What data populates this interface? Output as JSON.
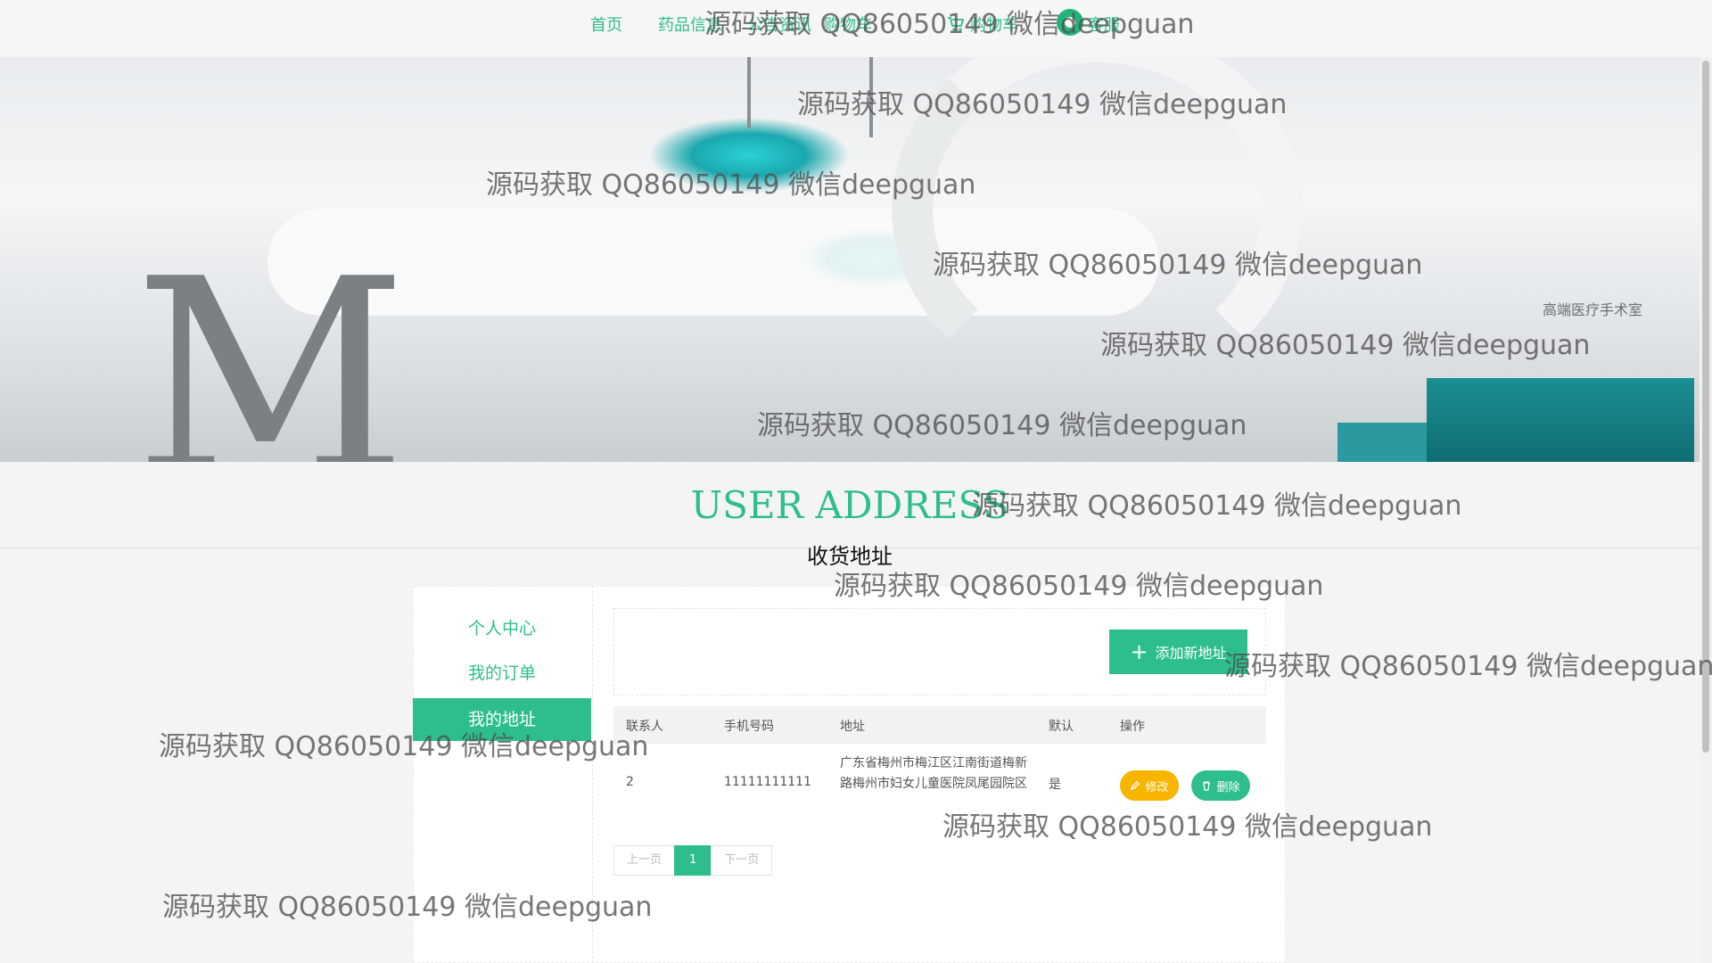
{
  "nav": {
    "items": [
      "首页",
      "药品信息",
      "公告资讯",
      "购物车",
      "客服"
    ],
    "cart_label": "购物车"
  },
  "banner": {
    "letter": "M",
    "sign": "高端医疗手术室"
  },
  "section": {
    "title": "USER ADDRESS",
    "subtitle": "收货地址"
  },
  "sidebar": {
    "items": [
      {
        "label": "个人中心",
        "active": false
      },
      {
        "label": "我的订单",
        "active": false
      },
      {
        "label": "我的地址",
        "active": true
      }
    ]
  },
  "toolbar": {
    "add_label": "添加新地址"
  },
  "table": {
    "headers": [
      "联系人",
      "手机号码",
      "地址",
      "默认",
      "操作"
    ],
    "rows": [
      {
        "contact": "2",
        "phone": "11111111111",
        "address": "广东省梅州市梅江区江南街道梅新路梅州市妇女儿童医院凤尾园院区",
        "default": "是",
        "edit": "修改",
        "delete": "删除"
      }
    ]
  },
  "pagination": {
    "prev": "上一页",
    "current": "1",
    "next": "下一页"
  },
  "watermark": "源码获取 QQ86050149 微信deepguan",
  "colors": {
    "accent": "#2dbe8c",
    "edit": "#f7b500"
  }
}
